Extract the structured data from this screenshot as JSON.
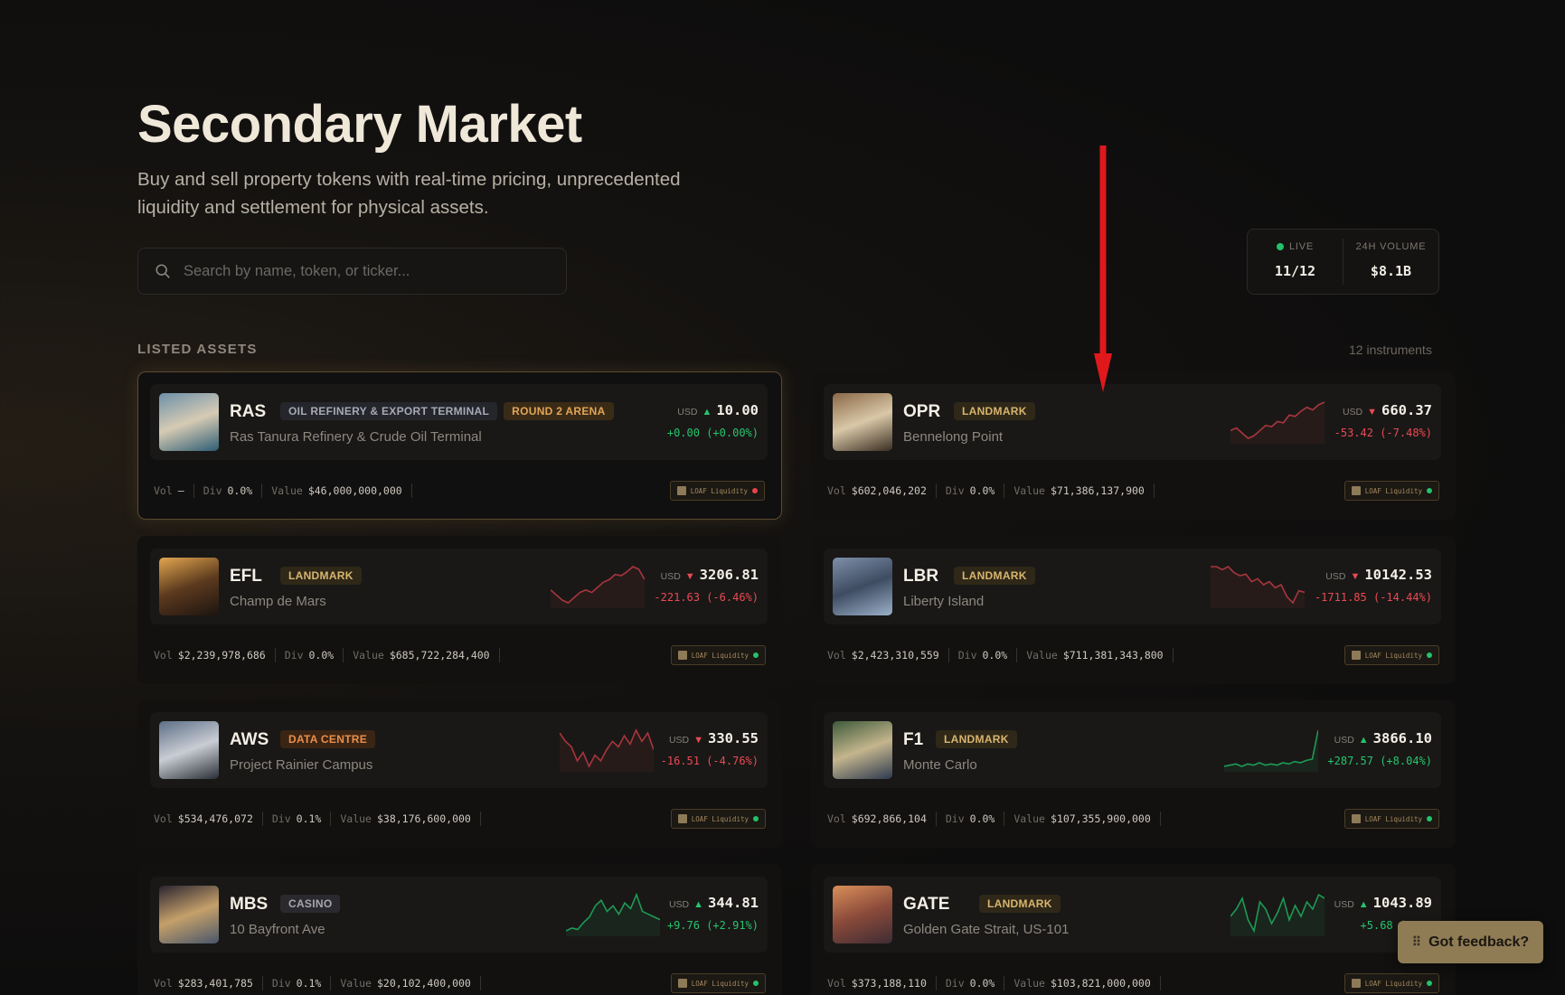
{
  "page": {
    "title": "Secondary Market",
    "subtitle": "Buy and sell property tokens with real-time pricing, unprecedented liquidity and settlement for physical assets."
  },
  "search": {
    "placeholder": "Search by name, token, or ticker..."
  },
  "stats": {
    "live_label": "LIVE",
    "live_value": "11/12",
    "volume_label": "24H VOLUME",
    "volume_value": "$8.1B"
  },
  "section": {
    "label": "LISTED ASSETS",
    "count": "12 instruments"
  },
  "labels": {
    "usd": "USD",
    "vol": "Vol",
    "div": "Div",
    "value": "Value",
    "badge": "LOAF Liquidity"
  },
  "assets": [
    {
      "ticker": "RAS",
      "tags": [
        "OIL REFINERY & EXPORT TERMINAL",
        "ROUND 2 ARENA"
      ],
      "place": "Ras Tanura Refinery & Crude Oil Terminal",
      "price": "10.00",
      "change": "+0.00 (+0.00%)",
      "direction": "up",
      "vol": "—",
      "div": "0.0%",
      "value": "$46,000,000,000",
      "status_color": "#e8434b",
      "sparkline": []
    },
    {
      "ticker": "OPR",
      "tags": [
        "LANDMARK"
      ],
      "place": "Bennelong Point",
      "price": "660.37",
      "change": "-53.42 (-7.48%)",
      "direction": "down",
      "vol": "$602,046,202",
      "div": "0.0%",
      "value": "$71,386,137,900",
      "status_color": "#22c26a",
      "sparkline": [
        40,
        42,
        38,
        34,
        36,
        40,
        44,
        43,
        47,
        46,
        52,
        51,
        55,
        58,
        56,
        60,
        62
      ]
    },
    {
      "ticker": "EFL",
      "tags": [
        "LANDMARK"
      ],
      "place": "Champ de Mars",
      "price": "3206.81",
      "change": "-221.63 (-6.46%)",
      "direction": "down",
      "vol": "$2,239,978,686",
      "div": "0.0%",
      "value": "$685,722,284,400",
      "status_color": "#22c26a",
      "sparkline": [
        44,
        40,
        36,
        34,
        38,
        42,
        44,
        42,
        46,
        50,
        52,
        56,
        55,
        58,
        62,
        60,
        52
      ]
    },
    {
      "ticker": "LBR",
      "tags": [
        "LANDMARK"
      ],
      "place": "Liberty Island",
      "price": "10142.53",
      "change": "-1711.85 (-14.44%)",
      "direction": "down",
      "vol": "$2,423,310,559",
      "div": "0.0%",
      "value": "$711,381,343,800",
      "status_color": "#22c26a",
      "sparkline": [
        60,
        60,
        58,
        60,
        56,
        54,
        55,
        50,
        52,
        48,
        50,
        46,
        48,
        40,
        36,
        44,
        43
      ]
    },
    {
      "ticker": "AWS",
      "tags": [
        "DATA CENTRE"
      ],
      "place": "Project Rainier Campus",
      "price": "330.55",
      "change": "-16.51 (-4.76%)",
      "direction": "down",
      "vol": "$534,476,072",
      "div": "0.1%",
      "value": "$38,176,600,000",
      "status_color": "#22c26a",
      "sparkline": [
        60,
        54,
        50,
        40,
        46,
        36,
        44,
        40,
        48,
        54,
        50,
        58,
        52,
        62,
        54,
        60,
        48
      ]
    },
    {
      "ticker": "F1",
      "tags": [
        "LANDMARK"
      ],
      "place": "Monte Carlo",
      "price": "3866.10",
      "change": "+287.57 (+8.04%)",
      "direction": "up",
      "vol": "$692,866,104",
      "div": "0.0%",
      "value": "$107,355,900,000",
      "status_color": "#22c26a",
      "sparkline": [
        40,
        41,
        42,
        40,
        42,
        41,
        43,
        41,
        42,
        41,
        43,
        42,
        44,
        43,
        45,
        46,
        70
      ]
    },
    {
      "ticker": "MBS",
      "tags": [
        "CASINO"
      ],
      "place": "10 Bayfront Ave",
      "price": "344.81",
      "change": "+9.76 (+2.91%)",
      "direction": "up",
      "vol": "$283,401,785",
      "div": "0.1%",
      "value": "$20,102,400,000",
      "status_color": "#22c26a",
      "sparkline": [
        40,
        42,
        41,
        46,
        50,
        58,
        62,
        54,
        58,
        52,
        60,
        56,
        66,
        54,
        52,
        50,
        48
      ]
    },
    {
      "ticker": "GATE",
      "tags": [
        "LANDMARK"
      ],
      "place": "Golden Gate Strait, US-101",
      "price": "1043.89",
      "change": "+5.68 (+0.5",
      "direction": "up",
      "vol": "$373,188,110",
      "div": "0.0%",
      "value": "$103,821,000,000",
      "status_color": "#22c26a",
      "sparkline": [
        50,
        54,
        60,
        48,
        42,
        58,
        54,
        46,
        52,
        60,
        48,
        56,
        50,
        58,
        54,
        62,
        60
      ]
    }
  ],
  "feedback": {
    "label": "Got feedback?"
  },
  "colors": {
    "accent": "#8f7c55",
    "up": "#27c46c",
    "down": "#ea4a52",
    "annotation_arrow": "#e0181c"
  },
  "icons": [
    "search-icon",
    "annotation-arrow-icon",
    "drag-dots-icon"
  ]
}
